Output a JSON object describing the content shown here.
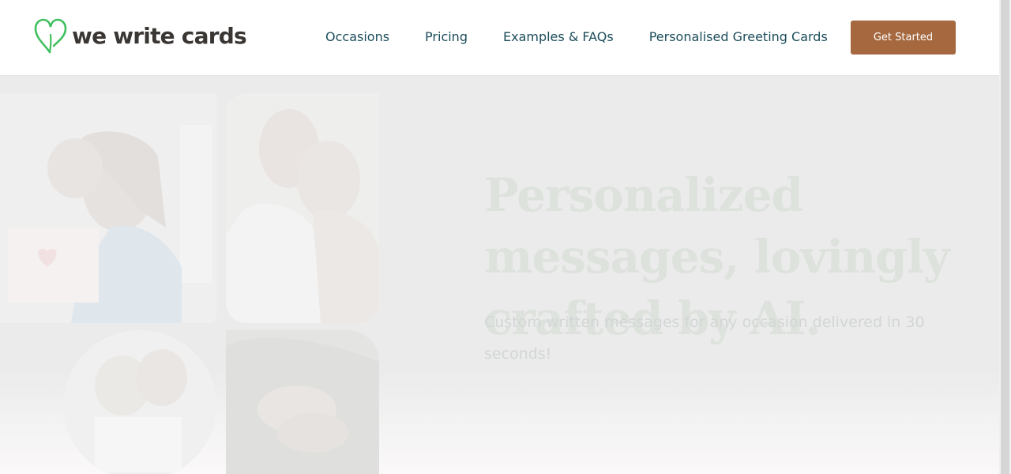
{
  "header": {
    "logo_text": "we write cards",
    "logo_icon": "heart-outline-icon",
    "brand_color": "#3fbf5e",
    "nav": [
      {
        "label": "Occasions"
      },
      {
        "label": "Pricing"
      },
      {
        "label": "Examples & FAQs"
      },
      {
        "label": "Personalised Greeting Cards"
      }
    ],
    "cta_label": "Get Started",
    "cta_color": "#a5683f"
  },
  "hero": {
    "title": "Personalized messages, lovingly crafted by AI.",
    "subtitle": "Custom written messages for any occasion delivered in 30 seconds!",
    "images": [
      {
        "name": "mother-daughter-card-photo"
      },
      {
        "name": "couple-kiss-photo"
      },
      {
        "name": "elderly-couple-photo"
      },
      {
        "name": "holding-hands-photo"
      }
    ]
  }
}
